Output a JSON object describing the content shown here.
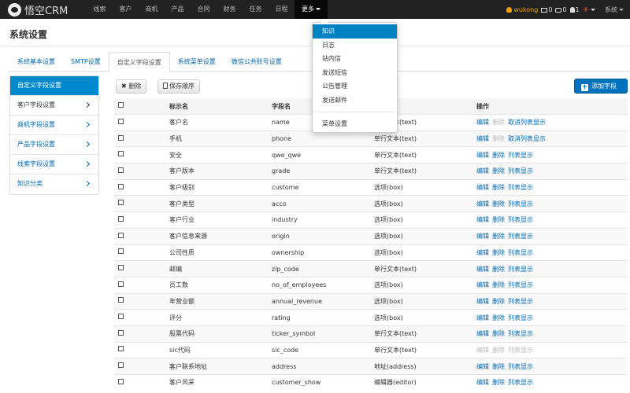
{
  "brand": {
    "name": "悟空CRM"
  },
  "nav": {
    "items": [
      "线索",
      "客户",
      "商机",
      "产品",
      "合同",
      "财务",
      "任务",
      "日程"
    ],
    "more": "更多"
  },
  "user": {
    "name": "wukong",
    "mail_count": "0",
    "msg_count": "0",
    "alert_count": "1",
    "system": "系统"
  },
  "page": {
    "title": "系统设置"
  },
  "tabs": [
    "系统基本设置",
    "SMTP设置",
    "自定义字段设置",
    "系统菜单设置",
    "微信公共账号设置"
  ],
  "sidebar": [
    {
      "label": "自定义字段设置"
    },
    {
      "label": "客户字段设置"
    },
    {
      "label": "商机字段设置"
    },
    {
      "label": "产品字段设置"
    },
    {
      "label": "线索字段设置"
    },
    {
      "label": "知识分类"
    }
  ],
  "toolbar": {
    "delete_label": "删除",
    "save_order_label": "保存顺序",
    "add_field_label": "添加字段"
  },
  "table": {
    "headers": {
      "label": "标示名",
      "field": "字段名",
      "type": "类型",
      "ops": "操作"
    },
    "ops_labels": {
      "edit": "编辑",
      "delete": "删除",
      "unlist": "取消列表显示",
      "list": "列表显示"
    },
    "rows": [
      {
        "label": "客户名",
        "field": "name",
        "type": "单行文本(text)"
      },
      {
        "label": "手机",
        "field": "phone",
        "type": "单行文本(text)"
      },
      {
        "label": "安全",
        "field": "qwe_qwe",
        "type": "单行文本(text)"
      },
      {
        "label": "客户版本",
        "field": "grade",
        "type": "单行文本(text)"
      },
      {
        "label": "客户级别",
        "field": "custome",
        "type": "选项(box)"
      },
      {
        "label": "客户类型",
        "field": "acco",
        "type": "选项(box)"
      },
      {
        "label": "客户行业",
        "field": "industry",
        "type": "选项(box)"
      },
      {
        "label": "客户信息来源",
        "field": "origin",
        "type": "选项(box)"
      },
      {
        "label": "公司性质",
        "field": "ownership",
        "type": "选项(box)"
      },
      {
        "label": "邮编",
        "field": "zip_code",
        "type": "单行文本(text)"
      },
      {
        "label": "员工数",
        "field": "no_of_employees",
        "type": "选项(box)"
      },
      {
        "label": "年营业额",
        "field": "annual_revenue",
        "type": "选项(box)"
      },
      {
        "label": "评分",
        "field": "rating",
        "type": "选项(box)"
      },
      {
        "label": "股票代码",
        "field": "ticker_symbol",
        "type": "单行文本(text)"
      },
      {
        "label": "sic代码",
        "field": "sic_code",
        "type": "单行文本(text)"
      },
      {
        "label": "客户联系地址",
        "field": "address",
        "type": "地址(address)"
      },
      {
        "label": "客户风采",
        "field": "customer_show",
        "type": "编辑器(editor)"
      }
    ]
  },
  "dropdown": {
    "items": [
      "知识",
      "日志",
      "站内信",
      "发送短信",
      "公告管理",
      "发送邮件"
    ],
    "menu_settings": "菜单设置"
  }
}
